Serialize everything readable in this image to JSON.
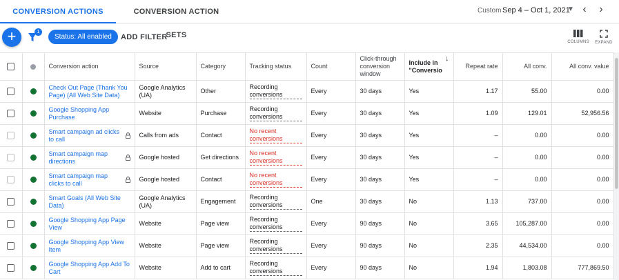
{
  "tabs": {
    "active": "CONVERSION ACTIONS",
    "inactive": "CONVERSION ACTION SETS"
  },
  "date": {
    "label": "Custom",
    "range": "Sep 4 – Oct 1, 2021"
  },
  "toolbar": {
    "filter_count": "1",
    "status_chip": "Status: All enabled",
    "add_filter": "ADD FILTER",
    "columns_label": "COLUMNS",
    "expand_label": "EXPAND"
  },
  "table": {
    "headers": {
      "conversion_action": "Conversion action",
      "source": "Source",
      "category": "Category",
      "tracking_status": "Tracking status",
      "count": "Count",
      "ctw": "Click-through conversion window",
      "include": "Include in \"Conversio",
      "repeat_rate": "Repeat rate",
      "all_conv": "All conv.",
      "all_conv_value": "All conv. value"
    },
    "rows": [
      {
        "name": "Check Out Page (Thank You Page) (All Web Site Data)",
        "locked": false,
        "source": "Google Analytics (UA)",
        "category": "Other",
        "status": "Recording conversions",
        "status_type": "ok",
        "count": "Every",
        "window": "30 days",
        "include": "Yes",
        "repeat": "1.17",
        "conv": "55.00",
        "value": "0.00"
      },
      {
        "name": "Google Shopping App Purchase",
        "locked": false,
        "source": "Website",
        "category": "Purchase",
        "status": "Recording conversions",
        "status_type": "ok",
        "count": "Every",
        "window": "30 days",
        "include": "Yes",
        "repeat": "1.09",
        "conv": "129.01",
        "value": "52,956.56"
      },
      {
        "name": "Smart campaign ad clicks to call",
        "locked": true,
        "source": "Calls from ads",
        "category": "Contact",
        "status": "No recent conversions",
        "status_type": "warn",
        "count": "Every",
        "window": "30 days",
        "include": "Yes",
        "repeat": "–",
        "conv": "0.00",
        "value": "0.00"
      },
      {
        "name": "Smart campaign map directions",
        "locked": true,
        "source": "Google hosted",
        "category": "Get directions",
        "status": "No recent conversions",
        "status_type": "warn",
        "count": "Every",
        "window": "30 days",
        "include": "Yes",
        "repeat": "–",
        "conv": "0.00",
        "value": "0.00"
      },
      {
        "name": "Smart campaign map clicks to call",
        "locked": true,
        "source": "Google hosted",
        "category": "Contact",
        "status": "No recent conversions",
        "status_type": "warn",
        "count": "Every",
        "window": "30 days",
        "include": "Yes",
        "repeat": "–",
        "conv": "0.00",
        "value": "0.00"
      },
      {
        "name": "Smart Goals (All Web Site Data)",
        "locked": false,
        "source": "Google Analytics (UA)",
        "category": "Engagement",
        "status": "Recording conversions",
        "status_type": "ok",
        "count": "One",
        "window": "30 days",
        "include": "No",
        "repeat": "1.13",
        "conv": "737.00",
        "value": "0.00"
      },
      {
        "name": "Google Shopping App Page View",
        "locked": false,
        "source": "Website",
        "category": "Page view",
        "status": "Recording conversions",
        "status_type": "ok",
        "count": "Every",
        "window": "90 days",
        "include": "No",
        "repeat": "3.65",
        "conv": "105,287.00",
        "value": "0.00"
      },
      {
        "name": "Google Shopping App View Item",
        "locked": false,
        "source": "Website",
        "category": "Page view",
        "status": "Recording conversions",
        "status_type": "ok",
        "count": "Every",
        "window": "90 days",
        "include": "No",
        "repeat": "2.35",
        "conv": "44,534.00",
        "value": "0.00"
      },
      {
        "name": "Google Shopping App Add To Cart",
        "locked": false,
        "source": "Website",
        "category": "Add to cart",
        "status": "Recording conversions",
        "status_type": "ok",
        "count": "Every",
        "window": "90 days",
        "include": "No",
        "repeat": "1.94",
        "conv": "1,803.08",
        "value": "777,869.50"
      }
    ]
  },
  "colors": {
    "accent": "#1a73e8",
    "enabled_dot": "#137333",
    "warning": "#d93025"
  }
}
